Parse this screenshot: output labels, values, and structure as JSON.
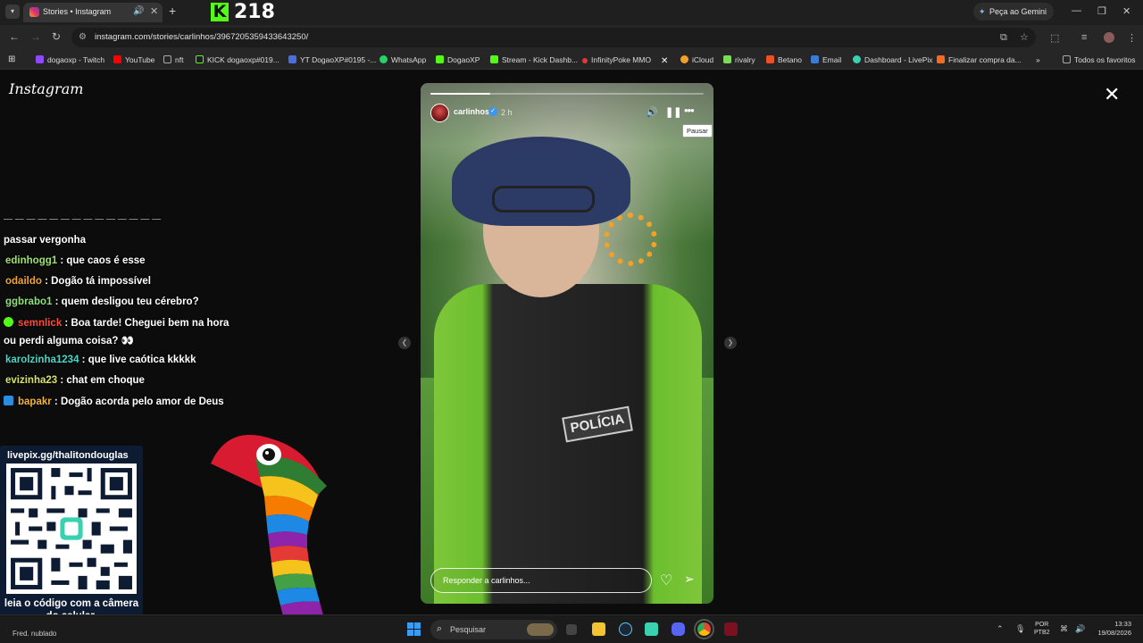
{
  "browser": {
    "tab_title": "Stories • Instagram",
    "kick_logo": "K",
    "kick_viewers": "218",
    "gemini_label": "Peça ao Gemini",
    "url": "instagram.com/stories/carlinhos/3967205359433643250/",
    "bookmarks": [
      {
        "label": "dogaoxp - Twitch",
        "color": "#9146ff"
      },
      {
        "label": "YouTube",
        "color": "#ff0000"
      },
      {
        "label": "nft",
        "color": "#777777"
      },
      {
        "label": "KICK dogaoxp#019...",
        "color": "#53fc18"
      },
      {
        "label": "YT DogaoXP#0195 -...",
        "color": "#4a6ee0"
      },
      {
        "label": "WhatsApp",
        "color": "#25d366"
      },
      {
        "label": "DogaoXP",
        "color": "#53fc18"
      },
      {
        "label": "Stream - Kick Dashb...",
        "color": "#53fc18"
      },
      {
        "label": "InfinityPoke MMO",
        "color": "#e53935"
      },
      {
        "label": "X",
        "color": "#000000"
      },
      {
        "label": "iCloud",
        "color": "#f2a12a"
      },
      {
        "label": "rivalry",
        "color": "#7ed957"
      },
      {
        "label": "Betano",
        "color": "#f04e23"
      },
      {
        "label": "Email",
        "color": "#3a7bd5"
      },
      {
        "label": "Dashboard - LivePix",
        "color": "#3ad1b0"
      },
      {
        "label": "Finalizar compra da...",
        "color": "#f26b21"
      }
    ],
    "all_bookmarks": "Todos os favoritos"
  },
  "instagram": {
    "logo": "Instagram",
    "close": "✕",
    "story": {
      "username": "carlinhos",
      "time": "2 h",
      "tooltip": "Pausar",
      "reply_placeholder": "Responder a carlinhos...",
      "progress_fraction": 0.22,
      "badge_text": "POLÍCIA"
    }
  },
  "chat": {
    "messages": [
      {
        "nick": "",
        "text": "passar vergonha",
        "color": "#ffffff",
        "badge": ""
      },
      {
        "nick": "edinhogg1",
        "text": " : que caos é esse",
        "color": "#9be36b",
        "badge": ""
      },
      {
        "nick": "odaildo",
        "text": " : Dogão tá impossível",
        "color": "#f2a33a",
        "badge": ""
      },
      {
        "nick": "ggbrabo1",
        "text": " : quem desligou teu cérebro?",
        "color": "#8fe07a",
        "badge": ""
      },
      {
        "nick": "semnlick",
        "text": " : Boa tarde! Cheguei bem na hora",
        "color": "#ff4a3a",
        "badge": "#53fc18"
      },
      {
        "nick": "",
        "text": "ou perdi alguma coisa? 👀",
        "color": "#ffffff",
        "badge": ""
      },
      {
        "nick": "karolzinha1234",
        "text": " : que live caótica kkkkk",
        "color": "#4ad6c8",
        "badge": ""
      },
      {
        "nick": "evizinha23",
        "text": " : chat em choque",
        "color": "#d9e36b",
        "badge": ""
      },
      {
        "nick": "bapakr",
        "text": " : Dogão acorda pelo amor de Deus",
        "color": "#f2b33a",
        "badge": "#2a8de0"
      }
    ]
  },
  "qr": {
    "url": "livepix.gg/thalitondouglas",
    "caption": "leia o código com a câmera do celular."
  },
  "taskbar": {
    "weather": "Fred. nublado",
    "search": "Pesquisar",
    "lang_line1": "POR",
    "lang_line2": "PTB2",
    "time": "13:33",
    "date": "19/08/2026"
  },
  "colors": {
    "kick_green": "#53fc18",
    "instagram_bg": "#0c0c0c",
    "chrome_bg": "#262626"
  }
}
